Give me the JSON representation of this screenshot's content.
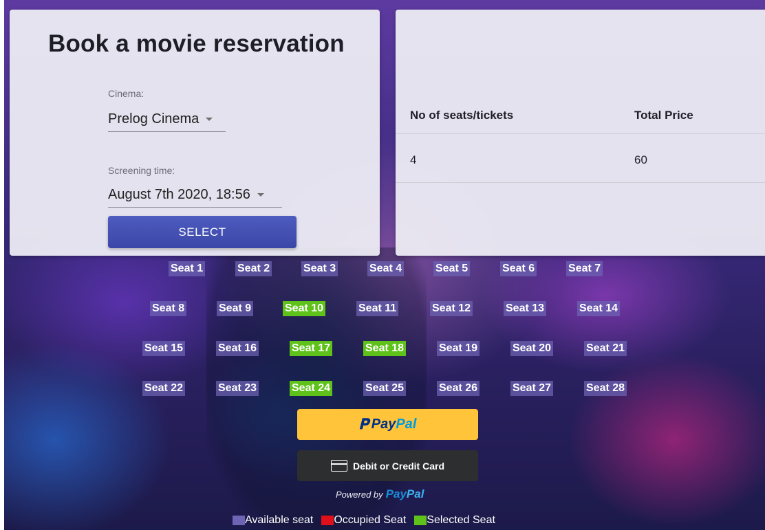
{
  "reservation": {
    "title": "Book a movie reservation",
    "cinema_label": "Cinema:",
    "cinema_value": "Prelog Cinema",
    "time_label": "Screening time:",
    "time_value": "August 7th 2020, 18:56",
    "select_label": "SELECT"
  },
  "summary": {
    "headers": [
      "No of seats/tickets",
      "Total Price"
    ],
    "row": [
      "4",
      "60"
    ]
  },
  "seats": [
    "Seat 1",
    "Seat 2",
    "Seat 3",
    "Seat 4",
    "Seat 5",
    "Seat 6",
    "Seat 7",
    "Seat 8",
    "Seat 9",
    "Seat 10",
    "Seat 11",
    "Seat 12",
    "Seat 13",
    "Seat 14",
    "Seat 15",
    "Seat 16",
    "Seat 17",
    "Seat 18",
    "Seat 19",
    "Seat 20",
    "Seat 21",
    "Seat 22",
    "Seat 23",
    "Seat 24",
    "Seat 25",
    "Seat 26",
    "Seat 27",
    "Seat 28"
  ],
  "selected_seats": [
    "Seat 10",
    "Seat 17",
    "Seat 18",
    "Seat 24"
  ],
  "payment": {
    "paypal_pay": "Pay",
    "paypal_pal": "Pal",
    "card_label": "Debit or Credit Card",
    "powered_by": "Powered by",
    "powered_pay": "Pay",
    "powered_pal": "Pal"
  },
  "legend": {
    "available": "Available seat",
    "occupied": "Occupied Seat",
    "selected": "Selected Seat"
  },
  "colors": {
    "available": "#6e64b4",
    "occupied": "#e0101a",
    "selected": "#5fc21a",
    "paypal_yellow": "#ffc439",
    "select_button": "#4452b4"
  }
}
